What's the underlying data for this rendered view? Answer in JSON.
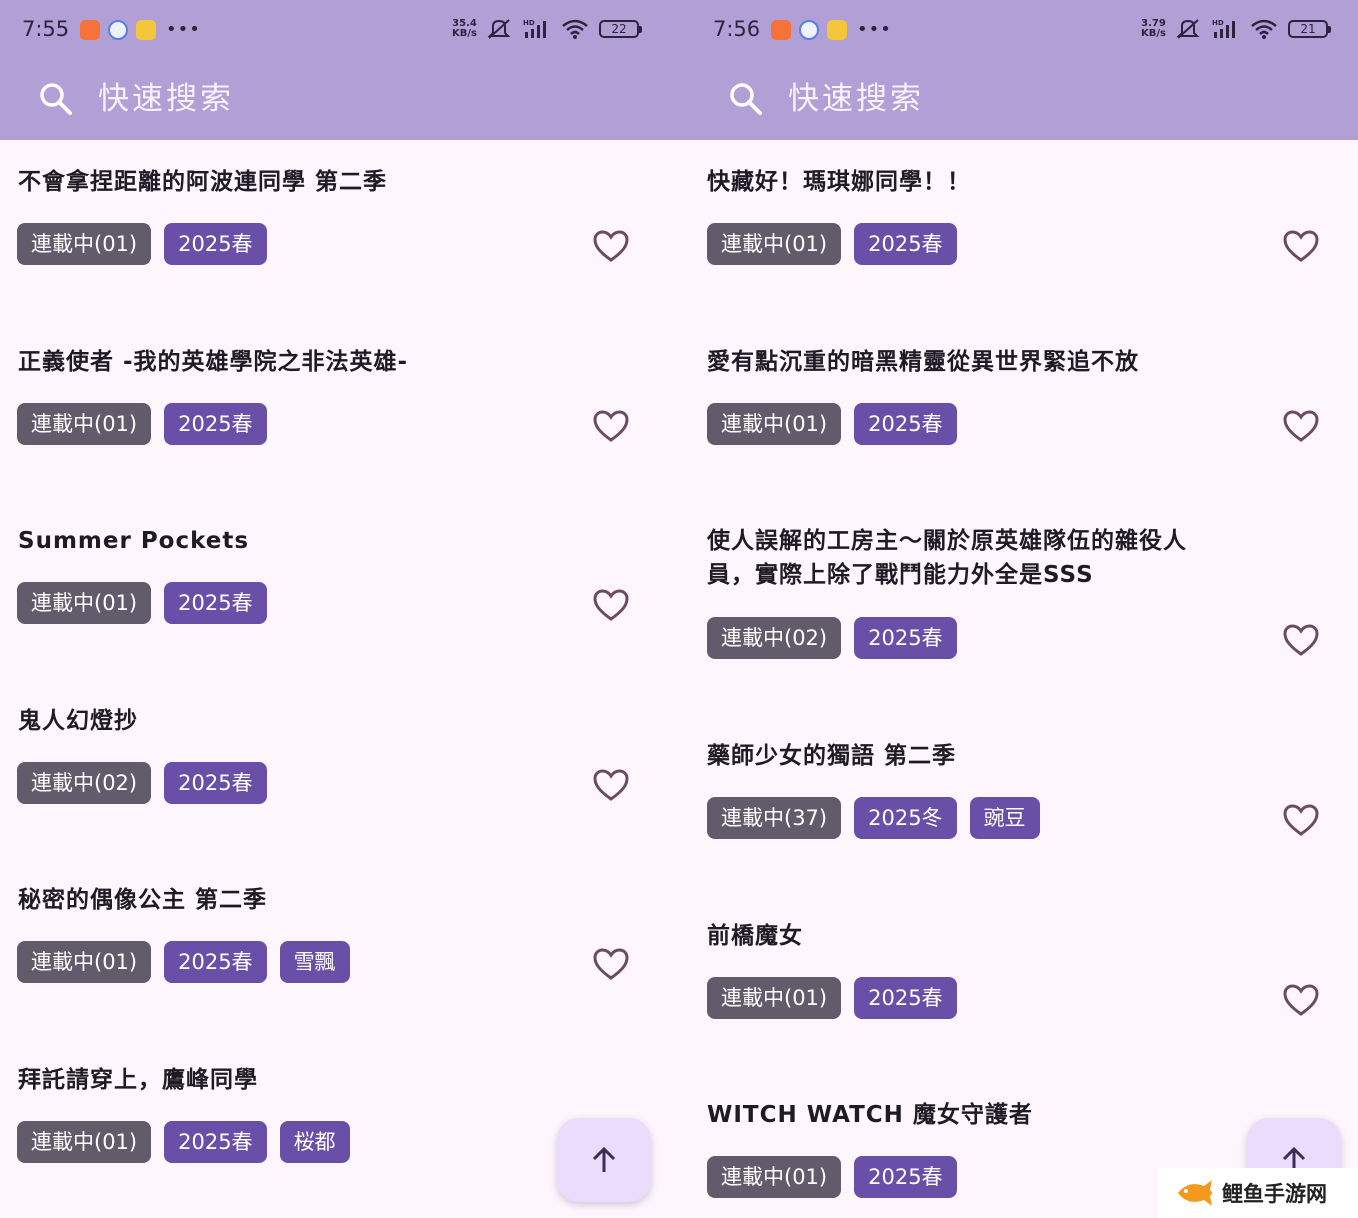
{
  "colors": {
    "header_bg": "#b1a0d5",
    "page_bg": "#fdf7fd",
    "status_tag_bg": "#615b6b",
    "season_tag_bg": "#6a4fa8",
    "fab_bg": "#eadcfb",
    "heart_stroke": "#6b4a62"
  },
  "left": {
    "status_bar": {
      "time": "7:55",
      "net_speed_value": "35.4",
      "net_speed_unit": "KB/s",
      "battery": "22"
    },
    "search": {
      "placeholder": "快速搜索",
      "icon": "search-icon"
    },
    "items": [
      {
        "title": "不會拿捏距離的阿波連同學 第二季",
        "tags": [
          "連載中(01)",
          "2025春"
        ]
      },
      {
        "title": "正義使者 -我的英雄學院之非法英雄-",
        "tags": [
          "連載中(01)",
          "2025春"
        ]
      },
      {
        "title": "Summer Pockets",
        "tags": [
          "連載中(01)",
          "2025春"
        ]
      },
      {
        "title": "鬼人幻燈抄",
        "tags": [
          "連載中(02)",
          "2025春"
        ]
      },
      {
        "title": "秘密的偶像公主 第二季",
        "tags": [
          "連載中(01)",
          "2025春",
          "雪飄"
        ]
      },
      {
        "title": "拜託請穿上，鷹峰同學",
        "tags": [
          "連載中(01)",
          "2025春",
          "桜都"
        ]
      }
    ],
    "fab_icon": "arrow-up-icon"
  },
  "right": {
    "status_bar": {
      "time": "7:56",
      "net_speed_value": "3.79",
      "net_speed_unit": "KB/s",
      "battery": "21"
    },
    "search": {
      "placeholder": "快速搜索",
      "icon": "search-icon"
    },
    "items": [
      {
        "title": "快藏好！瑪琪娜同學！！",
        "tags": [
          "連載中(01)",
          "2025春"
        ]
      },
      {
        "title": "愛有點沉重的暗黑精靈從異世界緊追不放",
        "tags": [
          "連載中(01)",
          "2025春"
        ]
      },
      {
        "title": "使人誤解的工房主～關於原英雄隊伍的雜役人員，實際上除了戰鬥能力外全是SSS",
        "tags": [
          "連載中(02)",
          "2025春"
        ]
      },
      {
        "title": "藥師少女的獨語 第二季",
        "tags": [
          "連載中(37)",
          "2025冬",
          "豌豆"
        ]
      },
      {
        "title": "前橋魔女",
        "tags": [
          "連載中(01)",
          "2025春"
        ]
      },
      {
        "title": "WITCH WATCH 魔女守護者",
        "tags": [
          "連載中(01)",
          "2025春"
        ]
      }
    ],
    "fab_icon": "arrow-up-icon"
  },
  "watermark": {
    "text": "鲤鱼手游网"
  }
}
